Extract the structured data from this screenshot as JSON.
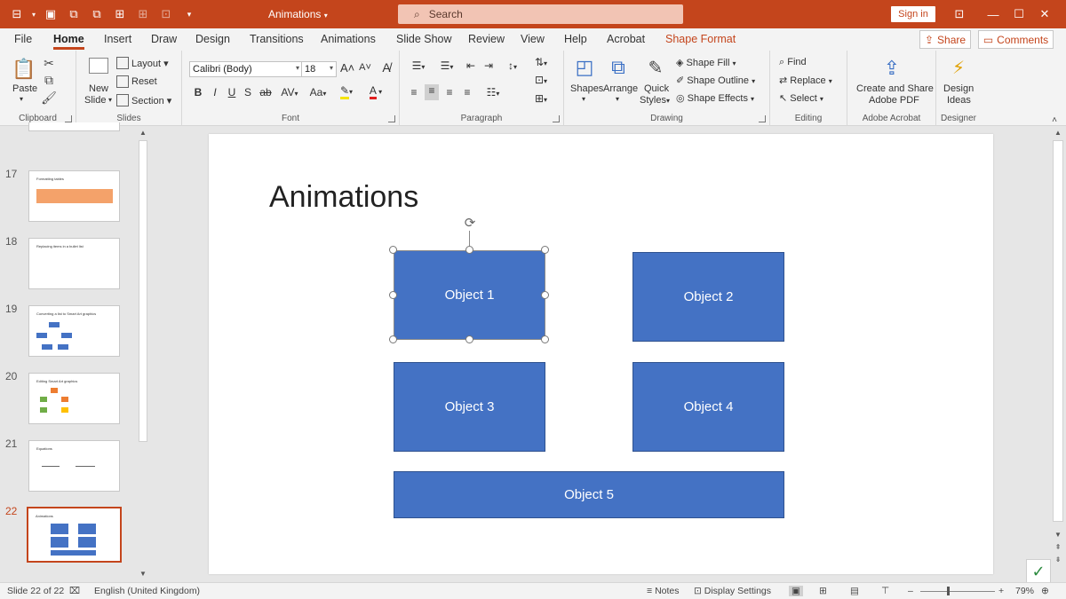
{
  "titlebar": {
    "doc_title": "Animations",
    "search_placeholder": "Search",
    "signin_label": "Sign in",
    "accent": "#c4451c"
  },
  "tabs": [
    {
      "label": "File"
    },
    {
      "label": "Home"
    },
    {
      "label": "Insert"
    },
    {
      "label": "Draw"
    },
    {
      "label": "Design"
    },
    {
      "label": "Transitions"
    },
    {
      "label": "Animations"
    },
    {
      "label": "Slide Show"
    },
    {
      "label": "Review"
    },
    {
      "label": "View"
    },
    {
      "label": "Help"
    },
    {
      "label": "Acrobat"
    },
    {
      "label": "Shape Format"
    }
  ],
  "share_label": "Share",
  "comments_label": "Comments",
  "ribbon": {
    "clipboard": {
      "paste": "Paste",
      "label": "Clipboard"
    },
    "slides": {
      "new_slide_1": "New",
      "new_slide_2": "Slide",
      "layout": "Layout",
      "reset": "Reset",
      "section": "Section",
      "label": "Slides"
    },
    "font": {
      "font_name": "Calibri (Body)",
      "font_size": "18",
      "label": "Font",
      "bold": "B",
      "italic": "I",
      "underline": "U",
      "shadow": "S",
      "strike": "ab",
      "spacing": "AV",
      "case": "Aa",
      "grow": "A",
      "shrink": "A"
    },
    "paragraph": {
      "label": "Paragraph"
    },
    "drawing": {
      "shapes": "Shapes",
      "arrange": "Arrange",
      "quick_styles_1": "Quick",
      "quick_styles_2": "Styles",
      "shape_fill": "Shape Fill",
      "shape_outline": "Shape Outline",
      "shape_effects": "Shape Effects",
      "label": "Drawing"
    },
    "editing": {
      "find": "Find",
      "replace": "Replace",
      "select": "Select",
      "label": "Editing"
    },
    "acrobat": {
      "create_1": "Create and Share",
      "create_2": "Adobe PDF",
      "label": "Adobe Acrobat"
    },
    "designer": {
      "ideas_1": "Design",
      "ideas_2": "Ideas",
      "label": "Designer"
    }
  },
  "thumbnails": [
    {
      "num": "17",
      "title": "Formatting tables"
    },
    {
      "num": "18",
      "title": "Replacing items in a bullet list"
    },
    {
      "num": "19",
      "title": "Converting a list to Smart Art graphics"
    },
    {
      "num": "20",
      "title": "Editing Smart Art graphics"
    },
    {
      "num": "21",
      "title": "Equations"
    },
    {
      "num": "22",
      "title": "Animations"
    }
  ],
  "slide": {
    "title": "Animations",
    "objects": [
      {
        "label": "Object 1"
      },
      {
        "label": "Object 2"
      },
      {
        "label": "Object 3"
      },
      {
        "label": "Object 4"
      },
      {
        "label": "Object 5"
      }
    ],
    "shape_color": "#4472c4"
  },
  "status": {
    "slide_count": "Slide 22 of 22",
    "language": "English (United Kingdom)",
    "notes": "Notes",
    "display_settings": "Display Settings",
    "zoom": "79%"
  }
}
